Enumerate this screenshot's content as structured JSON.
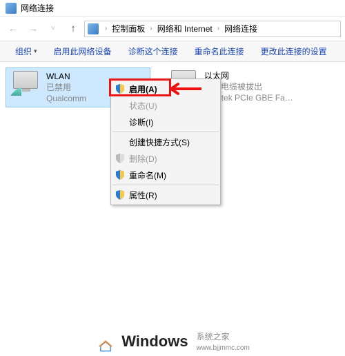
{
  "window": {
    "title": "网络连接"
  },
  "breadcrumb": {
    "root": "控制面板",
    "mid": "网络和 Internet",
    "leaf": "网络连接"
  },
  "toolbar": {
    "organize": "组织",
    "enable": "启用此网络设备",
    "diagnose": "诊断这个连接",
    "rename": "重命名此连接",
    "settings": "更改此连接的设置"
  },
  "adapters": [
    {
      "name": "WLAN",
      "status": "已禁用",
      "driver": "Qualcomm"
    },
    {
      "name": "以太网",
      "status": "网络电缆被拔出",
      "driver": "Realtek PCIe GBE Family..."
    }
  ],
  "context_menu": {
    "enable": "启用(A)",
    "status": "状态(U)",
    "diagnose": "诊断(I)",
    "shortcut": "创建快捷方式(S)",
    "delete": "删除(D)",
    "rename": "重命名(M)",
    "properties": "属性(R)"
  },
  "watermark": {
    "brand": "Windows",
    "sub": "系统之家",
    "url": "www.bjjmmc.com"
  }
}
